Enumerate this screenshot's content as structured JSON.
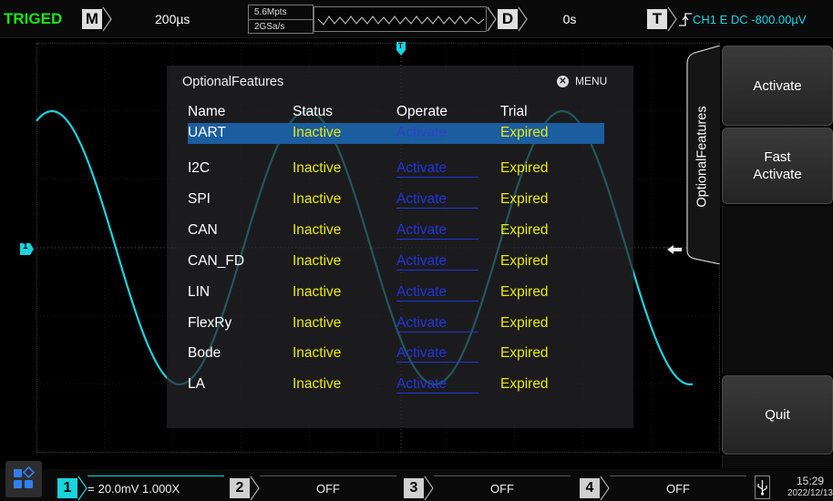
{
  "topbar": {
    "trigger_status": "TRIGED",
    "timebase_label": "M",
    "timebase": "200µs",
    "memory_depth": "5.6Mpts",
    "sample_rate": "2GSa/s",
    "delay_label": "D",
    "delay": "0s",
    "trigger_label": "T",
    "trigger_info": "CH1 E DC -800.00µV"
  },
  "markers": {
    "trigger_position": "T",
    "channel1": "1"
  },
  "dialog": {
    "title": "OptionalFeatures",
    "close_label": "MENU",
    "headers": {
      "name": "Name",
      "status": "Status",
      "operate": "Operate",
      "trial": "Trial"
    },
    "rows": [
      {
        "name": "UART",
        "status": "Inactive",
        "operate": "Activate",
        "trial": "Expired"
      },
      {
        "name": "I2C",
        "status": "Inactive",
        "operate": "Activate",
        "trial": "Expired"
      },
      {
        "name": "SPI",
        "status": "Inactive",
        "operate": "Activate",
        "trial": "Expired"
      },
      {
        "name": "CAN",
        "status": "Inactive",
        "operate": "Activate",
        "trial": "Expired"
      },
      {
        "name": "CAN_FD",
        "status": "Inactive",
        "operate": "Activate",
        "trial": "Expired"
      },
      {
        "name": "LIN",
        "status": "Inactive",
        "operate": "Activate",
        "trial": "Expired"
      },
      {
        "name": "FlexRy",
        "status": "Inactive",
        "operate": "Activate",
        "trial": "Expired"
      },
      {
        "name": "Bode",
        "status": "Inactive",
        "operate": "Activate",
        "trial": "Expired"
      },
      {
        "name": "LA",
        "status": "Inactive",
        "operate": "Activate",
        "trial": "Expired"
      }
    ]
  },
  "menu": {
    "tab_title": "OptionalFeatures",
    "activate": "Activate",
    "fast_activate_line1": "Fast",
    "fast_activate_line2": "Activate",
    "quit": "Quit"
  },
  "bottombar": {
    "ch1": {
      "label": "1",
      "coupling_symbol": "=",
      "setting": "20.0mV 1.000X"
    },
    "ch2": {
      "label": "2",
      "setting": "OFF"
    },
    "ch3": {
      "label": "3",
      "setting": "OFF"
    },
    "ch4": {
      "label": "4",
      "setting": "OFF"
    },
    "time": "15:29",
    "date": "2022/12/13"
  },
  "colors": {
    "channel1": "#19d3de",
    "channel2": "#e8e813",
    "channel3": "#e040e0",
    "channel4": "#2f7ff0",
    "trigger_status": "#19e619",
    "selection": "#1b5d9e"
  },
  "icons": {
    "usb": "usb-icon",
    "apps": "apps-icon",
    "trigger_edge": "rising-edge-icon",
    "close": "close-circle-icon"
  }
}
